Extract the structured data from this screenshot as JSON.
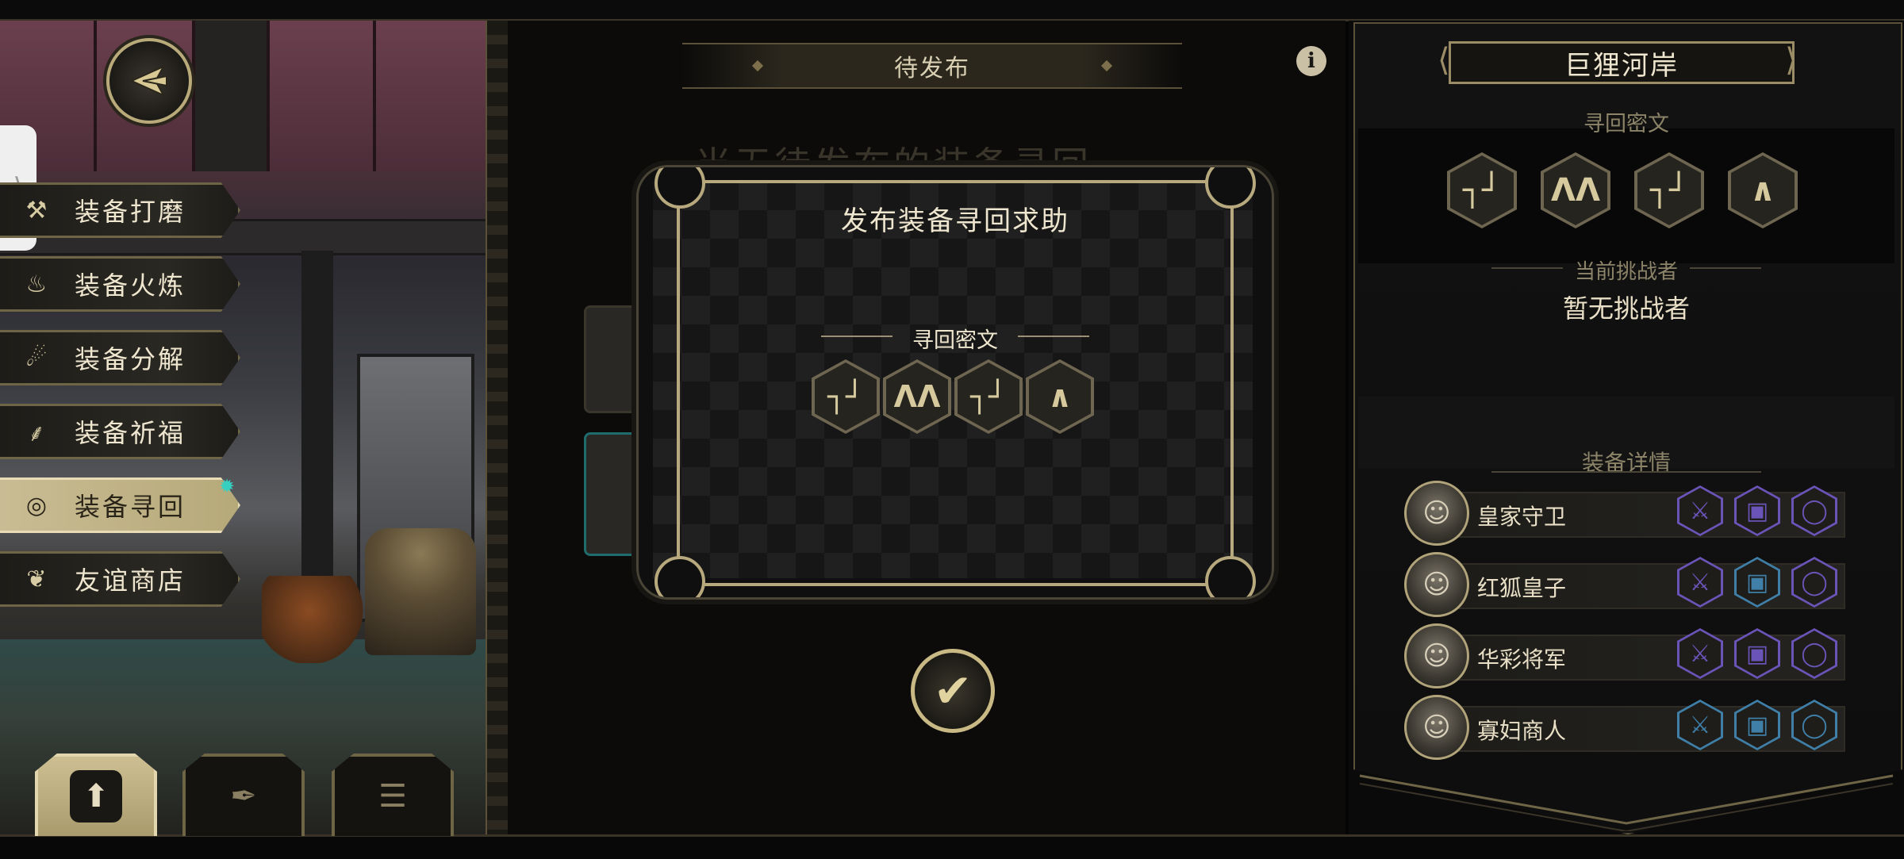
{
  "menu": {
    "items": [
      {
        "label": "装备打磨",
        "icon": "hammer-icon"
      },
      {
        "label": "装备火炼",
        "icon": "flame-icon"
      },
      {
        "label": "装备分解",
        "icon": "disassemble-icon"
      },
      {
        "label": "装备祈福",
        "icon": "praying-hands-icon"
      },
      {
        "label": "装备寻回",
        "icon": "target-icon",
        "active": true
      },
      {
        "label": "友谊商店",
        "icon": "fox-icon"
      }
    ]
  },
  "tools": [
    {
      "icon": "upload-document-icon",
      "selected": true
    },
    {
      "icon": "feather-icon",
      "selected": false
    },
    {
      "icon": "list-icon",
      "selected": false
    }
  ],
  "center": {
    "tab_title": "待发布",
    "background_heading": "当无待发布的装备寻回"
  },
  "modal": {
    "title": "发布装备寻回求助",
    "cipher_label": "寻回密文",
    "cipher_glyphs": [
      "┐┘",
      "ΛΛ",
      "┐┘",
      "∧"
    ]
  },
  "right": {
    "location_name": "巨狸河岸",
    "cipher_label": "寻回密文",
    "challenger_label": "当前挑战者",
    "challenger_value": "暂无挑战者",
    "detail_label": "装备详情",
    "heroes": [
      {
        "name": "皇家守卫",
        "gear_colors": [
          "#6a54b8",
          "#6a54b8",
          "#6a54b8"
        ]
      },
      {
        "name": "红狐皇子",
        "gear_colors": [
          "#6a54b8",
          "#3f7fa8",
          "#6a54b8"
        ]
      },
      {
        "name": "华彩将军",
        "gear_colors": [
          "#6a54b8",
          "#6a54b8",
          "#6a54b8"
        ]
      },
      {
        "name": "寡妇商人",
        "gear_colors": [
          "#3f7fa8",
          "#3f7fa8",
          "#3f7fa8"
        ]
      }
    ]
  },
  "colors": {
    "accent_gold": "#b7a97d",
    "active_menu_bg": "#c9bc94",
    "spark": "#36d0c0"
  }
}
